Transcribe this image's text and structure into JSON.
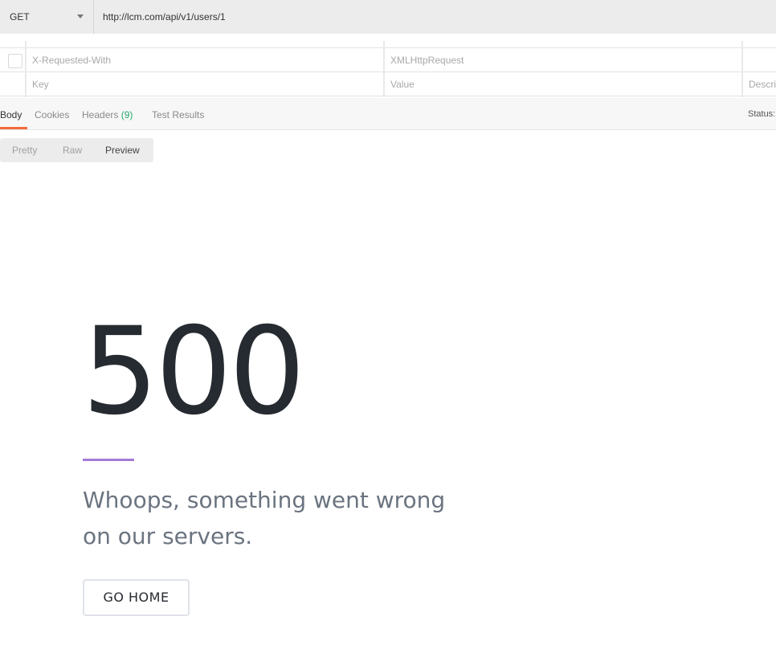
{
  "request": {
    "method": "GET",
    "url": "http://lcm.com/api/v1/users/1"
  },
  "headers_table": {
    "rows": [
      {
        "key": "X-Requested-With",
        "value": "XMLHttpRequest",
        "description": ""
      }
    ],
    "placeholder": {
      "key": "Key",
      "value": "Value",
      "description": "Descri"
    }
  },
  "response_tabs": {
    "body": "Body",
    "cookies": "Cookies",
    "headers": "Headers",
    "headers_count": "(9)",
    "tests": "Test Results",
    "active": "Body",
    "status_label": "Status:"
  },
  "view_modes": {
    "pretty": "Pretty",
    "raw": "Raw",
    "preview": "Preview",
    "active": "Preview"
  },
  "preview": {
    "code": "500",
    "message_line1": "Whoops, something went wrong",
    "message_line2": "on our servers.",
    "button": "GO HOME"
  },
  "colors": {
    "tab_active_underline": "#f26b3a",
    "headers_count": "#27a86b",
    "accent_line": "#a67ad8",
    "error_code": "#262b31",
    "error_message": "#6b7480"
  }
}
